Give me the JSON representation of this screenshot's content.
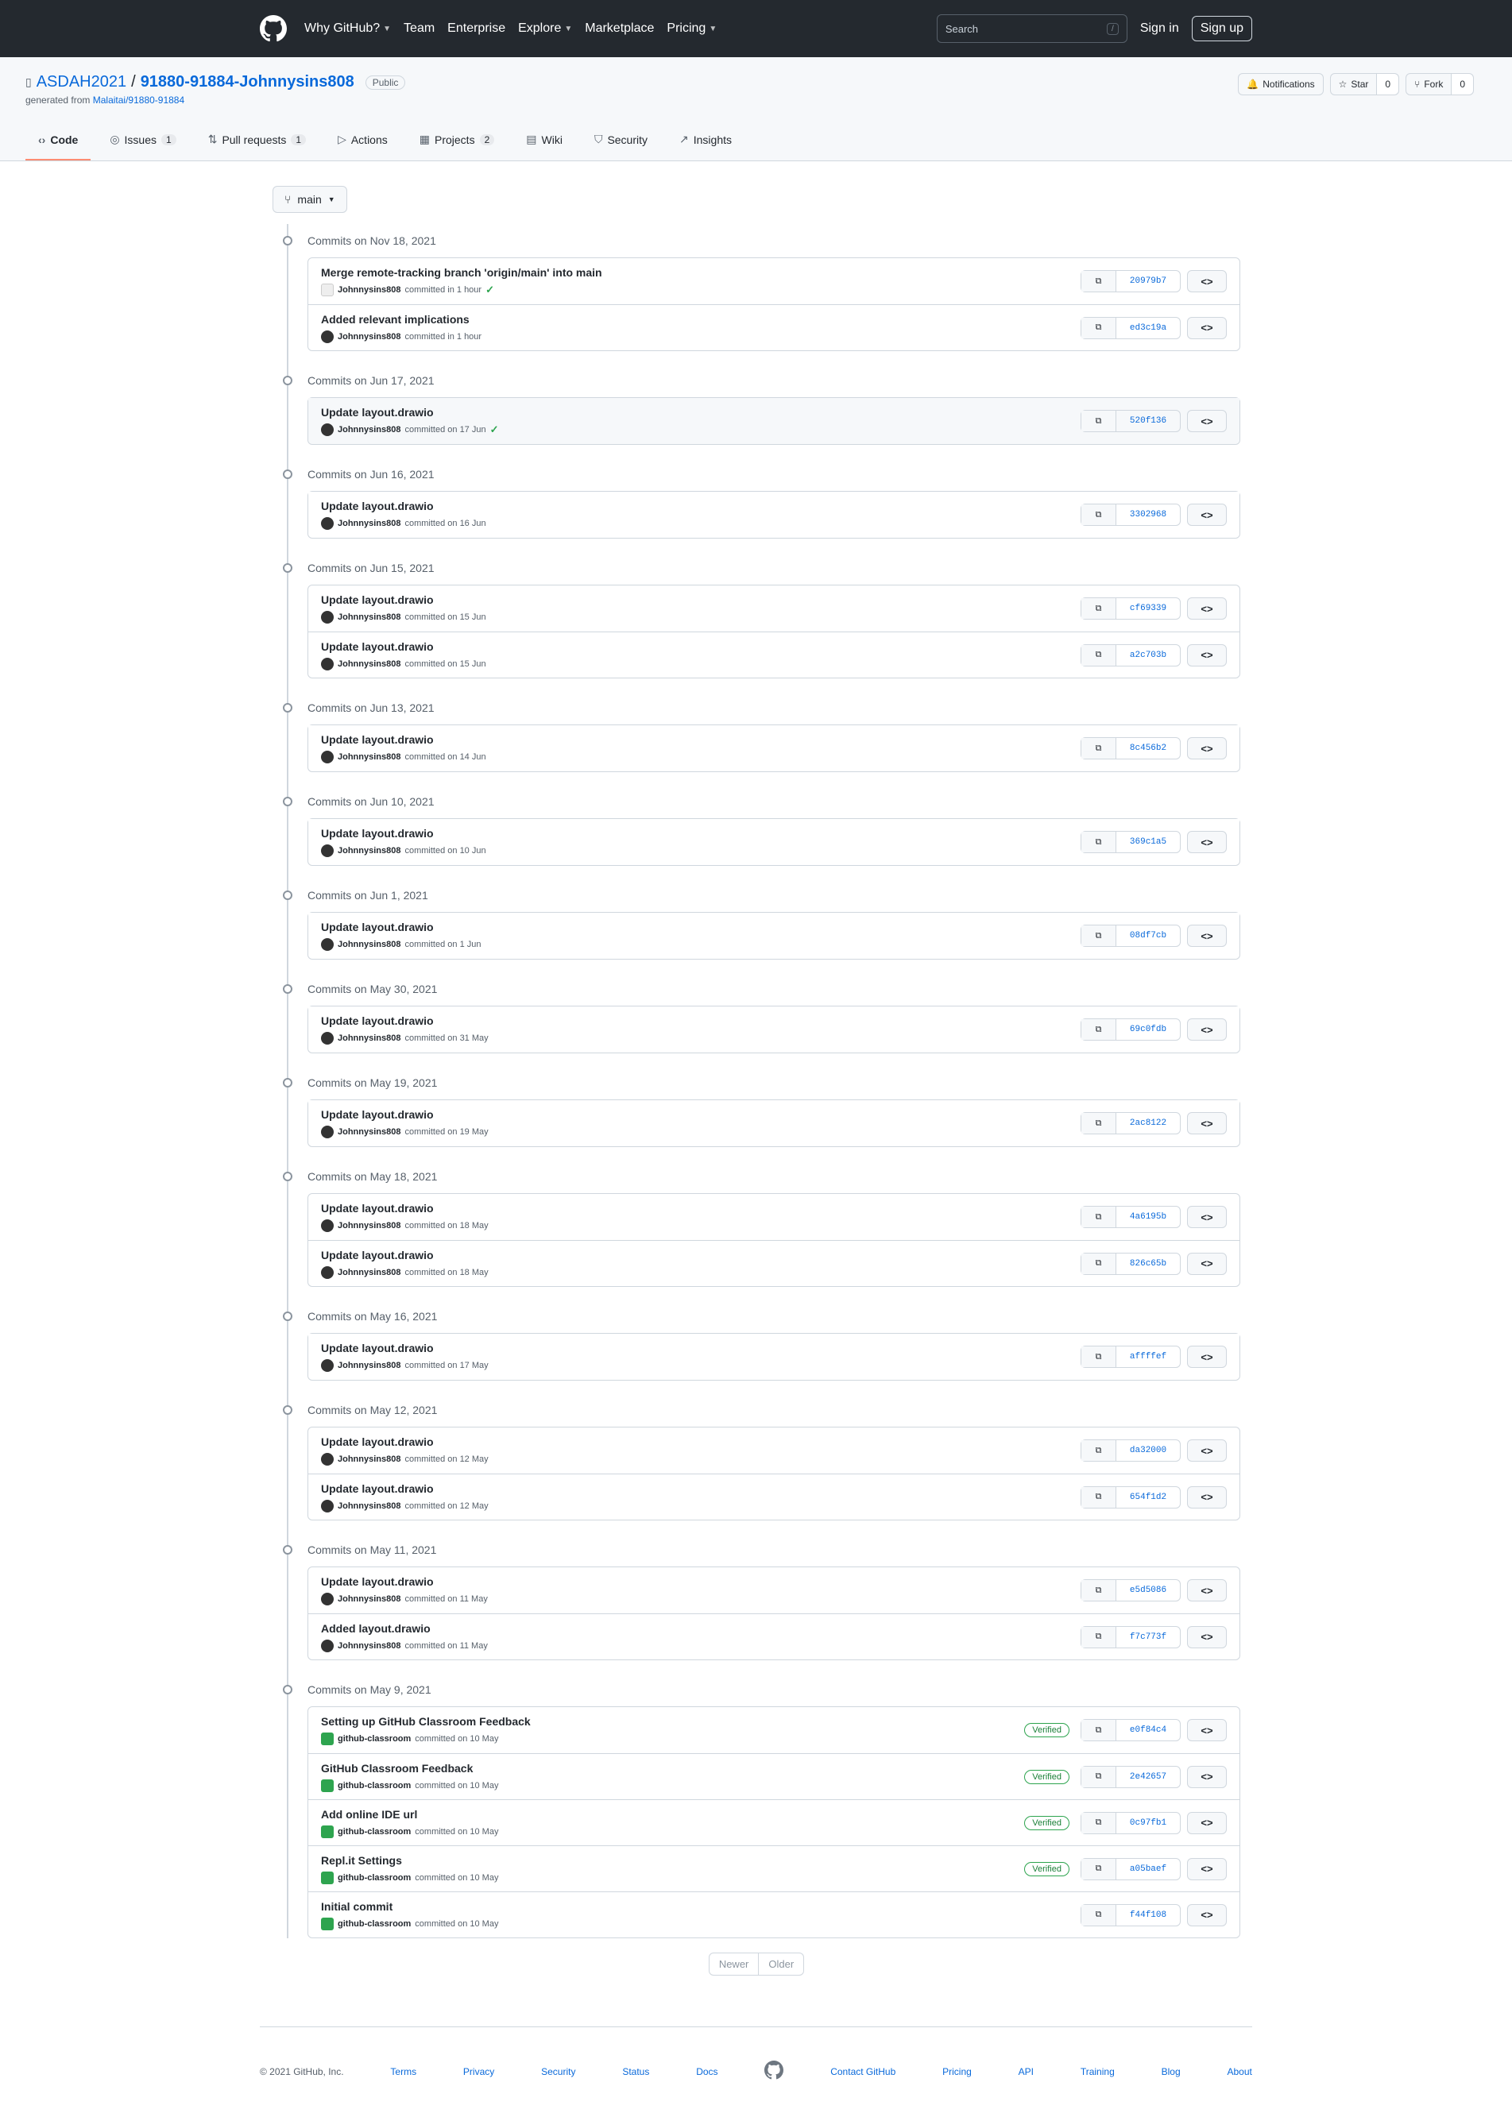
{
  "header": {
    "nav": [
      {
        "label": "Why GitHub?",
        "caret": true
      },
      {
        "label": "Team",
        "caret": false
      },
      {
        "label": "Enterprise",
        "caret": false
      },
      {
        "label": "Explore",
        "caret": true
      },
      {
        "label": "Marketplace",
        "caret": false
      },
      {
        "label": "Pricing",
        "caret": true
      }
    ],
    "search_placeholder": "Search",
    "search_key": "/",
    "signin": "Sign in",
    "signup": "Sign up"
  },
  "repo": {
    "owner": "ASDAH2021",
    "sep": "/",
    "name": "91880-91884-Johnnysins808",
    "visibility": "Public",
    "generated_prefix": "generated from",
    "generated_link": "Malaitai/91880-91884",
    "notifications": "Notifications",
    "star": "Star",
    "star_count": "0",
    "fork": "Fork",
    "fork_count": "0"
  },
  "tabs": [
    {
      "label": "Code",
      "icon": "code-icon",
      "count": "",
      "selected": true
    },
    {
      "label": "Issues",
      "icon": "issue-icon",
      "count": "1"
    },
    {
      "label": "Pull requests",
      "icon": "pull-request-icon",
      "count": "1"
    },
    {
      "label": "Actions",
      "icon": "play-icon",
      "count": ""
    },
    {
      "label": "Projects",
      "icon": "project-icon",
      "count": "2"
    },
    {
      "label": "Wiki",
      "icon": "book-icon",
      "count": ""
    },
    {
      "label": "Security",
      "icon": "shield-icon",
      "count": ""
    },
    {
      "label": "Insights",
      "icon": "graph-icon",
      "count": ""
    }
  ],
  "branch": "main",
  "groups": [
    {
      "date": "Commits on Nov 18, 2021",
      "commits": [
        {
          "msg": "Merge remote-tracking branch 'origin/main' into main",
          "author": "Johnnysins808",
          "when": "committed in 1 hour",
          "avatar": "bot",
          "check": true,
          "verified": false,
          "sha": "20979b7"
        },
        {
          "msg": "Added relevant implications",
          "author": "Johnnysins808",
          "when": "committed in 1 hour",
          "avatar": "user",
          "check": false,
          "verified": false,
          "sha": "ed3c19a"
        }
      ]
    },
    {
      "date": "Commits on Jun 17, 2021",
      "commits": [
        {
          "msg": "Update layout.drawio",
          "author": "Johnnysins808",
          "when": "committed on 17 Jun",
          "avatar": "user",
          "check": true,
          "verified": false,
          "sha": "520f136",
          "hl": true
        }
      ]
    },
    {
      "date": "Commits on Jun 16, 2021",
      "commits": [
        {
          "msg": "Update layout.drawio",
          "author": "Johnnysins808",
          "when": "committed on 16 Jun",
          "avatar": "user",
          "check": false,
          "verified": false,
          "sha": "3302968"
        }
      ]
    },
    {
      "date": "Commits on Jun 15, 2021",
      "commits": [
        {
          "msg": "Update layout.drawio",
          "author": "Johnnysins808",
          "when": "committed on 15 Jun",
          "avatar": "user",
          "sha": "cf69339"
        },
        {
          "msg": "Update layout.drawio",
          "author": "Johnnysins808",
          "when": "committed on 15 Jun",
          "avatar": "user",
          "sha": "a2c703b"
        }
      ]
    },
    {
      "date": "Commits on Jun 13, 2021",
      "commits": [
        {
          "msg": "Update layout.drawio",
          "author": "Johnnysins808",
          "when": "committed on 14 Jun",
          "avatar": "user",
          "sha": "8c456b2"
        }
      ]
    },
    {
      "date": "Commits on Jun 10, 2021",
      "commits": [
        {
          "msg": "Update layout.drawio",
          "author": "Johnnysins808",
          "when": "committed on 10 Jun",
          "avatar": "user",
          "sha": "369c1a5"
        }
      ]
    },
    {
      "date": "Commits on Jun 1, 2021",
      "commits": [
        {
          "msg": "Update layout.drawio",
          "author": "Johnnysins808",
          "when": "committed on 1 Jun",
          "avatar": "user",
          "sha": "08df7cb"
        }
      ]
    },
    {
      "date": "Commits on May 30, 2021",
      "commits": [
        {
          "msg": "Update layout.drawio",
          "author": "Johnnysins808",
          "when": "committed on 31 May",
          "avatar": "user",
          "sha": "69c0fdb"
        }
      ]
    },
    {
      "date": "Commits on May 19, 2021",
      "commits": [
        {
          "msg": "Update layout.drawio",
          "author": "Johnnysins808",
          "when": "committed on 19 May",
          "avatar": "user",
          "sha": "2ac8122"
        }
      ]
    },
    {
      "date": "Commits on May 18, 2021",
      "commits": [
        {
          "msg": "Update layout.drawio",
          "author": "Johnnysins808",
          "when": "committed on 18 May",
          "avatar": "user",
          "sha": "4a6195b"
        },
        {
          "msg": "Update layout.drawio",
          "author": "Johnnysins808",
          "when": "committed on 18 May",
          "avatar": "user",
          "sha": "826c65b"
        }
      ]
    },
    {
      "date": "Commits on May 16, 2021",
      "commits": [
        {
          "msg": "Update layout.drawio",
          "author": "Johnnysins808",
          "when": "committed on 17 May",
          "avatar": "user",
          "sha": "affffef"
        }
      ]
    },
    {
      "date": "Commits on May 12, 2021",
      "commits": [
        {
          "msg": "Update layout.drawio",
          "author": "Johnnysins808",
          "when": "committed on 12 May",
          "avatar": "user",
          "sha": "da32000"
        },
        {
          "msg": "Update layout.drawio",
          "author": "Johnnysins808",
          "when": "committed on 12 May",
          "avatar": "user",
          "sha": "654f1d2"
        }
      ]
    },
    {
      "date": "Commits on May 11, 2021",
      "commits": [
        {
          "msg": "Update layout.drawio",
          "author": "Johnnysins808",
          "when": "committed on 11 May",
          "avatar": "user",
          "sha": "e5d5086"
        },
        {
          "msg": "Added layout.drawio",
          "author": "Johnnysins808",
          "when": "committed on 11 May",
          "avatar": "user",
          "sha": "f7c773f"
        }
      ]
    },
    {
      "date": "Commits on May 9, 2021",
      "commits": [
        {
          "msg": "Setting up GitHub Classroom Feedback",
          "author": "github-classroom",
          "when": "committed on 10 May",
          "avatar": "gh",
          "verified": true,
          "sha": "e0f84c4"
        },
        {
          "msg": "GitHub Classroom Feedback",
          "author": "github-classroom",
          "when": "committed on 10 May",
          "avatar": "gh",
          "verified": true,
          "sha": "2e42657"
        },
        {
          "msg": "Add online IDE url",
          "author": "github-classroom",
          "when": "committed on 10 May",
          "avatar": "gh",
          "verified": true,
          "sha": "0c97fb1"
        },
        {
          "msg": "Repl.it Settings",
          "author": "github-classroom",
          "when": "committed on 10 May",
          "avatar": "gh",
          "verified": true,
          "sha": "a05baef"
        },
        {
          "msg": "Initial commit",
          "author": "github-classroom",
          "when": "committed on 10 May",
          "avatar": "gh",
          "verified": false,
          "sha": "f44f108"
        }
      ]
    }
  ],
  "verified_label": "Verified",
  "pager": {
    "newer": "Newer",
    "older": "Older"
  },
  "footer": {
    "copyright": "© 2021 GitHub, Inc.",
    "left": [
      "Terms",
      "Privacy",
      "Security",
      "Status",
      "Docs"
    ],
    "right": [
      "Contact GitHub",
      "Pricing",
      "API",
      "Training",
      "Blog",
      "About"
    ]
  }
}
